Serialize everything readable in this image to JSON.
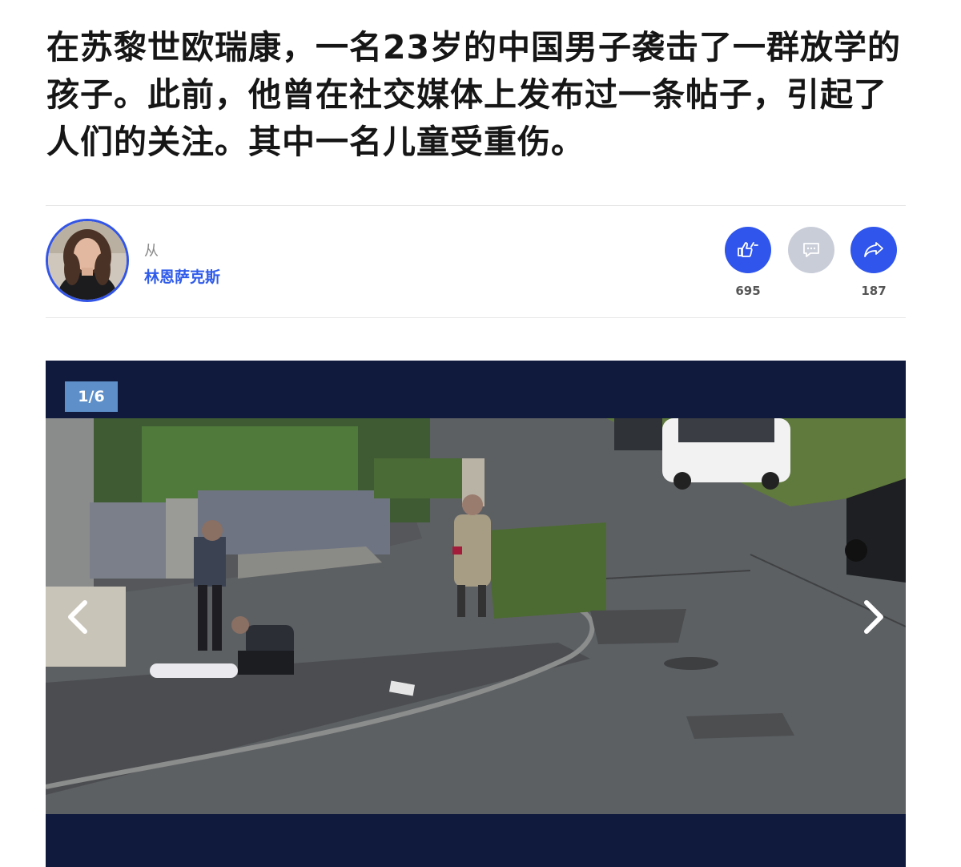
{
  "article": {
    "headline": "在苏黎世欧瑞康，一名23岁的中国男子袭击了一群放学的孩子。此前，他曾在社交媒体上发布过一条帖子，引起了人们的关注。其中一名儿童受重伤。"
  },
  "byline": {
    "from_label": "从",
    "author": "林恩萨克斯"
  },
  "actions": {
    "like_count": "695",
    "share_count": "187",
    "like_icon": "thumbs-up-down-icon",
    "comment_icon": "comment-icon",
    "share_icon": "share-arrow-icon"
  },
  "gallery": {
    "counter": "1/6",
    "prev_icon": "chevron-left-icon",
    "next_icon": "chevron-right-icon"
  },
  "colors": {
    "accent": "#2f55ec",
    "author_link": "#2f5bea",
    "gallery_bg": "#0f1a3d",
    "counter_badge": "#5e8fc8",
    "comment_button": "#c9cdd8"
  }
}
